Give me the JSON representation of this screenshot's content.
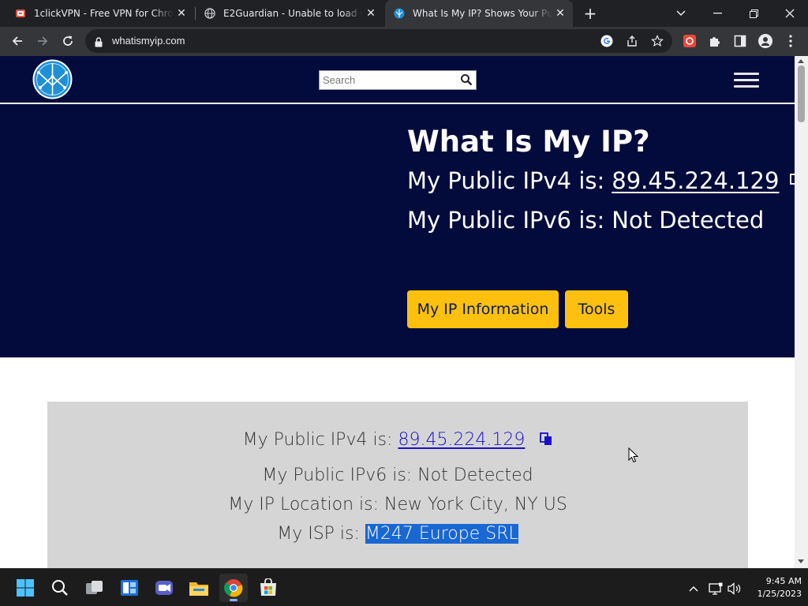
{
  "browser": {
    "tabs": [
      {
        "title": "1clickVPN - Free VPN for Chrome",
        "icon": "vpn-icon",
        "active": false
      },
      {
        "title": "E2Guardian - Unable to load web",
        "icon": "globe-icon",
        "active": false
      },
      {
        "title": "What Is My IP? Shows Your Public",
        "icon": "site-logo-icon",
        "active": true
      }
    ],
    "url": "whatismyip.com"
  },
  "site": {
    "search_placeholder": "Search",
    "hero": {
      "title": "What Is My IP?",
      "ipv4_label": "My Public IPv4 is:",
      "ipv4_value": "89.45.224.129",
      "ipv6_label": "My Public IPv6 is:",
      "ipv6_value": "Not Detected",
      "btn_ip_info": "My IP Information",
      "btn_tools": "Tools"
    },
    "info": {
      "ipv4_label": "My Public IPv4 is:",
      "ipv4_value": "89.45.224.129",
      "ipv6_text": "My Public IPv6 is: Not Detected",
      "location_text": "My IP Location is: New York City, NY US",
      "isp_label": "My ISP is:",
      "isp_value": "M247 Europe SRL"
    }
  },
  "taskbar": {
    "time": "9:45 AM",
    "date": "1/25/2023"
  },
  "colors": {
    "navy": "#020b3b",
    "yellow": "#fdc00e",
    "link_blue": "#1a0dcc",
    "selection": "#1967d2"
  }
}
